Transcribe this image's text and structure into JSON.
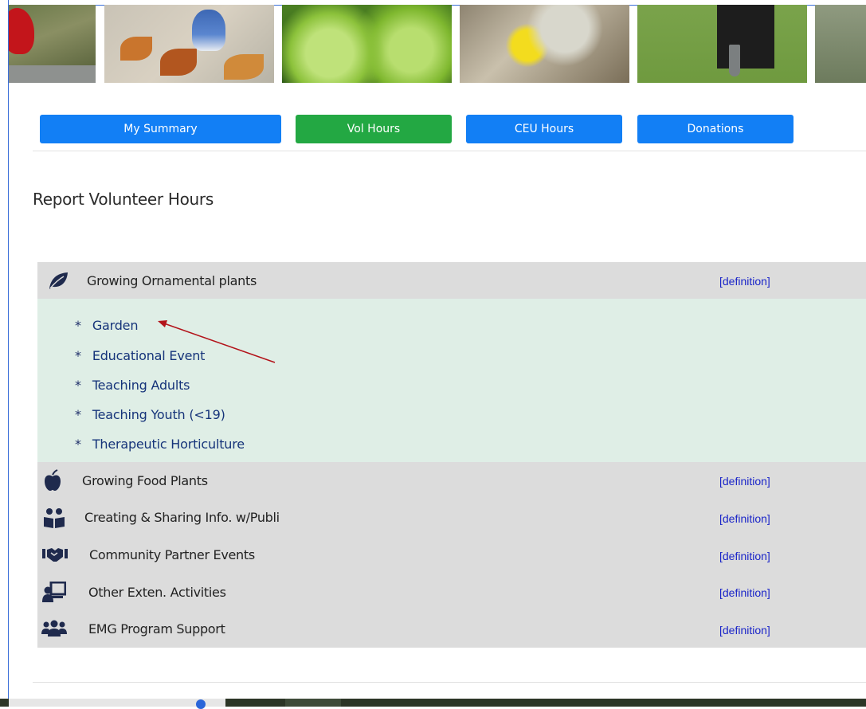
{
  "banner": {
    "photos": [
      "cardinal-photo",
      "blue-jay-photo",
      "green-tomatoes-photo",
      "dandelion-spider-photo",
      "compost-shovel-photo",
      "garden-photo"
    ]
  },
  "nav": {
    "summary": "My Summary",
    "vol_hours": "Vol Hours",
    "ceu_hours": "CEU Hours",
    "donations": "Donations"
  },
  "page_title": "Report Volunteer Hours",
  "categories": [
    {
      "label": "Growing Ornamental plants",
      "icon": "leaf-icon",
      "definition": "[definition]",
      "subitems": [
        "Garden",
        "Educational Event",
        "Teaching Adults",
        "Teaching Youth (<19)",
        "Therapeutic Horticulture"
      ]
    },
    {
      "label": "Growing Food Plants",
      "icon": "apple-icon",
      "definition": "[definition]"
    },
    {
      "label": "Creating & Sharing Info. w/Publi",
      "icon": "reading-people-icon",
      "definition": "[definition]"
    },
    {
      "label": "Community Partner Events",
      "icon": "handshake-icon",
      "definition": "[definition]"
    },
    {
      "label": "Other Exten. Activities",
      "icon": "presenter-icon",
      "definition": "[definition]"
    },
    {
      "label": "EMG Program Support",
      "icon": "users-icon",
      "definition": "[definition]"
    }
  ],
  "star": "*",
  "colors": {
    "nav_blue": "#127ff5",
    "nav_green": "#23a843",
    "category_bg": "#dcdcdc",
    "expanded_bg": "#dfeee6",
    "link_blue": "#1a25c8",
    "annotation_arrow": "#b3131a"
  }
}
